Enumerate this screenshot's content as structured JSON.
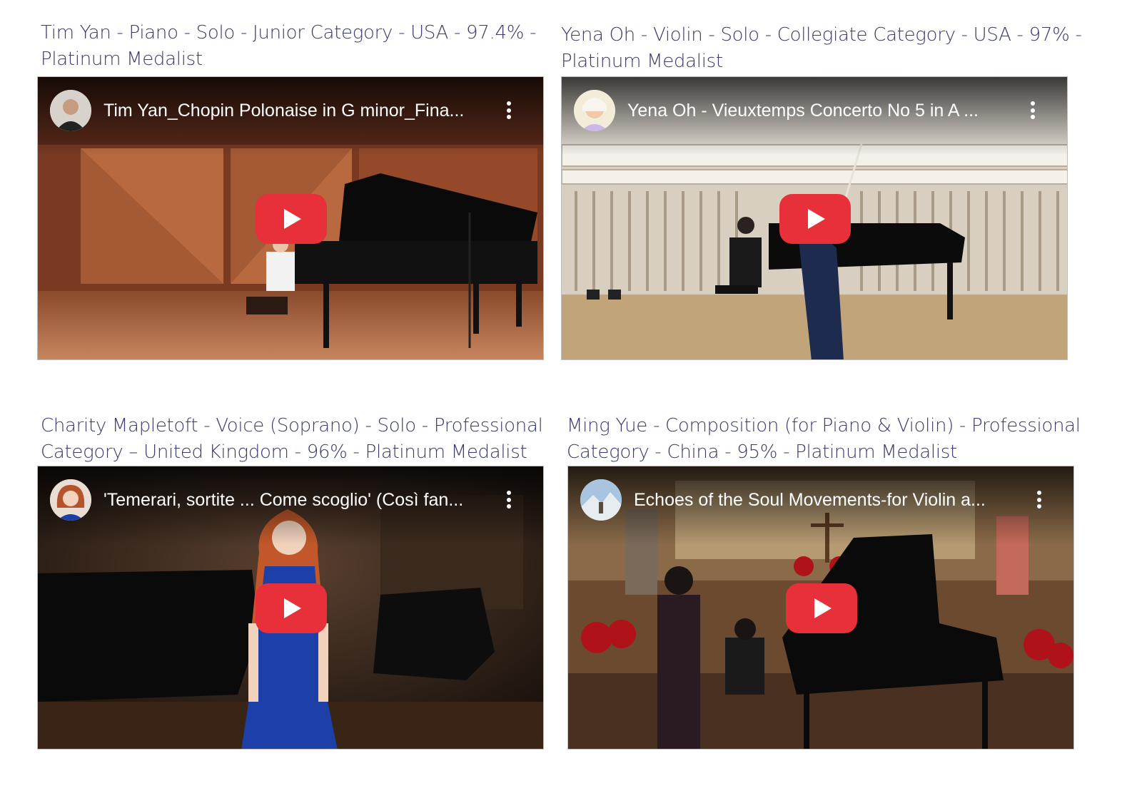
{
  "colors": {
    "caption_text": "#3b3a6e",
    "play_button": "#e8303a",
    "play_triangle": "#ffffff"
  },
  "icons": {
    "play": "play-button-icon",
    "menu": "more-vertical-icon"
  },
  "entries": [
    {
      "caption_line1": "Tim Yan - Piano - Solo - Junior Category - USA - 97.4% -",
      "caption_line2": "Platinum Medalist",
      "video_title": "Tim Yan_Chopin Polonaise in G minor_Fina..."
    },
    {
      "caption_line1": "Yena Oh - Violin - Solo - Collegiate Category - USA - 97% -",
      "caption_line2": "Platinum Medalist",
      "video_title": "Yena Oh - Vieuxtemps Concerto No 5 in A ..."
    },
    {
      "caption_line1": "Charity Mapletoft - Voice (Soprano) - Solo - Professional",
      "caption_line2": "Category – United Kingdom - 96% - Platinum Medalist",
      "video_title": "'Temerari, sortite ... Come scoglio' (Così fan..."
    },
    {
      "caption_line1": "Ming Yue - Composition (for Piano & Violin) - Professional",
      "caption_line2": "Category - China  - 95% - Platinum Medalist",
      "video_title": "Echoes of the Soul Movements-for Violin a..."
    }
  ]
}
